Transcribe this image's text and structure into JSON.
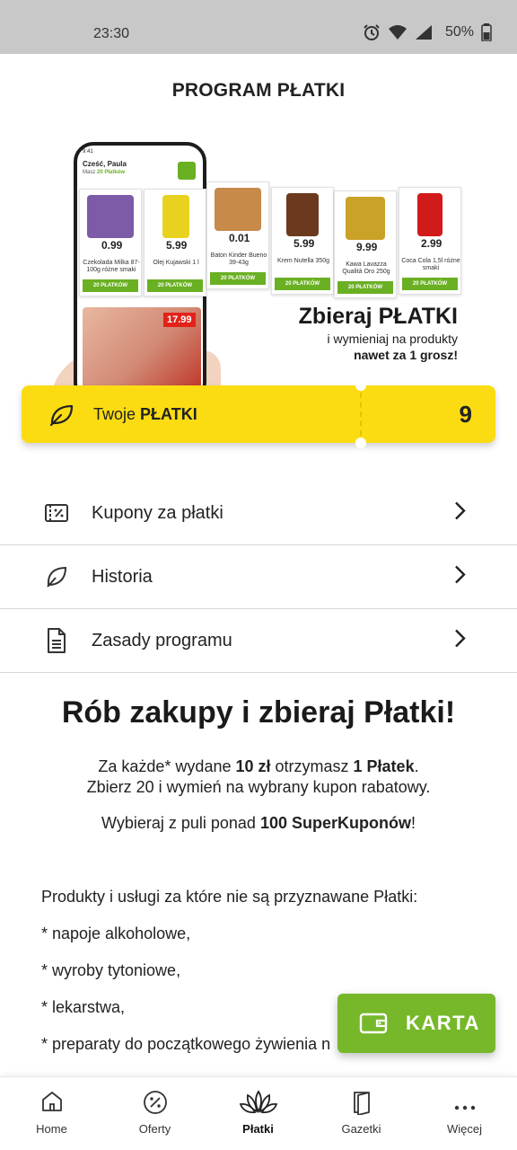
{
  "status_bar": {
    "time": "23:30",
    "battery": "50%"
  },
  "header": {
    "title": "PROGRAM PŁATKI"
  },
  "banner": {
    "phone": {
      "time": "9:41",
      "greeting": "Cześć, Paula",
      "subtitle_prefix": "Masz",
      "subtitle_points": "20 Płatków",
      "price": "17.99"
    },
    "products": [
      {
        "price": "0.99",
        "name": "Czekolada Milka 87-100g różne smaki",
        "cta": "20 PŁATKÓW",
        "color": "#7d5ba6"
      },
      {
        "price": "5.99",
        "name": "Olej Kujawski 1 l",
        "cta": "20 PŁATKÓW",
        "color": "#e9d21f"
      },
      {
        "price": "0.01",
        "name": "Baton Kinder Bueno 39-43g",
        "cta": "20 PŁATKÓW",
        "color": "#c78a4a"
      },
      {
        "price": "5.99",
        "name": "Krem Nutella 350g",
        "cta": "20 PŁATKÓW",
        "color": "#6b3a1e"
      },
      {
        "price": "9.99",
        "name": "Kawa Lavazza Qualità Oro 250g",
        "cta": "20 PŁATKÓW",
        "color": "#c9a227"
      },
      {
        "price": "2.99",
        "name": "Coca Cola 1,5l różne smaki",
        "cta": "20 PŁATKÓW",
        "color": "#d11a1a"
      }
    ],
    "tagline_line1": "Zbieraj PŁATKI",
    "tagline_line2": "i wymieniaj na produkty",
    "tagline_line3": "nawet za 1 grosz!"
  },
  "points_card": {
    "label_prefix": "Twoje ",
    "label_bold": "PŁATKI",
    "value": "9"
  },
  "menu": {
    "items": [
      {
        "label": "Kupony za płatki",
        "icon": "coupon-icon"
      },
      {
        "label": "Historia",
        "icon": "leaf-icon"
      },
      {
        "label": "Zasady programu",
        "icon": "document-icon"
      }
    ]
  },
  "info": {
    "heading": "Rób zakupy i zbieraj Płatki!",
    "para1_a": "Za każde* wydane ",
    "para1_b": "10 zł",
    "para1_c": " otrzymasz ",
    "para1_d": "1 Płatek",
    "para1_e": ".",
    "para2": "Zbierz 20 i wymień na wybrany kupon rabatowy.",
    "para3_a": "Wybieraj z puli ponad ",
    "para3_b": "100 SuperKuponów",
    "para3_c": "!",
    "exclusions_intro": "Produkty i usługi za które nie są przyznawane Płatki:",
    "exclusions": [
      "* napoje alkoholowe,",
      "* wyroby tytoniowe,",
      "* lekarstwa,",
      "* preparaty do początkowego żywienia n"
    ]
  },
  "karta_button": {
    "label": "KARTA"
  },
  "bottom_nav": {
    "items": [
      {
        "label": "Home",
        "icon": "home-icon"
      },
      {
        "label": "Oferty",
        "icon": "percent-icon"
      },
      {
        "label": "Płatki",
        "icon": "flower-icon",
        "active": true
      },
      {
        "label": "Gazetki",
        "icon": "newspaper-icon"
      },
      {
        "label": "Więcej",
        "icon": "more-dots-icon"
      }
    ]
  },
  "colors": {
    "accent_green": "#76b82a",
    "accent_yellow": "#fbdc13",
    "status_bar": "#c8c8c8"
  }
}
